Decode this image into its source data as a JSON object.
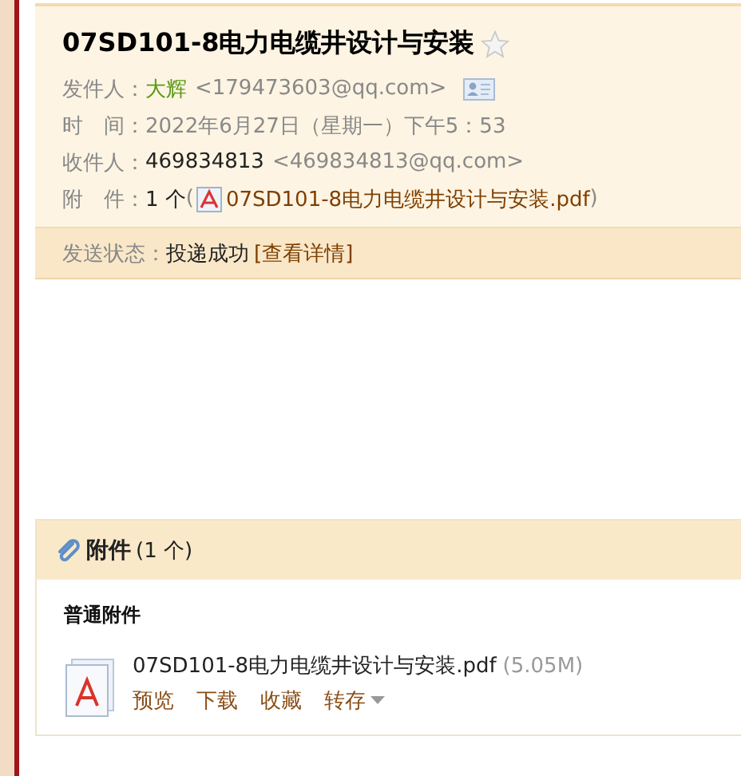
{
  "mail": {
    "title": "07SD101-8电力电缆井设计与安装",
    "starred": false,
    "fields": [
      {
        "kind": "sender",
        "label": "发件人：",
        "name": "大辉",
        "address": "<179473603@qq.com>"
      },
      {
        "kind": "plain",
        "label": "时　间：",
        "value": "2022年6月27日（星期一）下午5：53"
      },
      {
        "kind": "recipient",
        "label": "收件人：",
        "name": "469834813",
        "address": "<469834813@qq.com>"
      },
      {
        "kind": "attachment",
        "label": "附　件：",
        "count": "1 个",
        "open": "(",
        "file": "07SD101-8电力电缆井设计与安装.pdf",
        "close": ")"
      }
    ],
    "status": {
      "label": "发送状态：",
      "value": "投递成功",
      "link": "[查看详情]"
    }
  },
  "attachments": {
    "title": "附件",
    "count": "(1 个)",
    "section": "普通附件",
    "files": [
      {
        "name": "07SD101-8电力电缆井设计与安装.pdf",
        "size": "(5.05M)",
        "actions": [
          {
            "label": "预览",
            "kind": "link"
          },
          {
            "label": "下载",
            "kind": "link"
          },
          {
            "label": "收藏",
            "kind": "link"
          },
          {
            "label": "转存",
            "kind": "menu"
          }
        ]
      }
    ]
  }
}
